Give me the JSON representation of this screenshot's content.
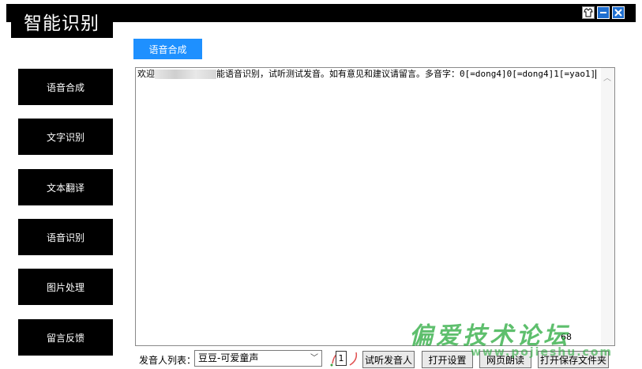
{
  "app": {
    "title": "智能识别"
  },
  "window_controls": {
    "skin": "skin-icon",
    "minimize": "minimize-icon",
    "close": "close-icon"
  },
  "sidebar": {
    "items": [
      {
        "label": "语音合成"
      },
      {
        "label": "文字识别"
      },
      {
        "label": "文本翻译"
      },
      {
        "label": "语音识别"
      },
      {
        "label": "图片处理"
      },
      {
        "label": "留言反馈"
      }
    ]
  },
  "main": {
    "active_tab": "语音合成",
    "editor": {
      "text_before": "欢迎",
      "text_after": "能语音识别，试听测试发音。如有意见和建议请留言。多音字：0[=dong4]0[=dong4]1[=yao1]",
      "char_count": "68"
    },
    "voice_list_label": "发音人列表：",
    "voice_selected": "豆豆-可爱童声",
    "speed_value": "1",
    "buttons": {
      "try_voice": "试听发音人",
      "open_settings": "打开设置",
      "web_read": "网页朗读",
      "open_folder": "打开保存文件夹"
    }
  },
  "watermark": {
    "main": "偏爱技术论坛",
    "sub": "www.pojieshu.com"
  },
  "colors": {
    "accent": "#1e90ff",
    "nav_bg": "#000000",
    "title_bg": "#000000"
  }
}
